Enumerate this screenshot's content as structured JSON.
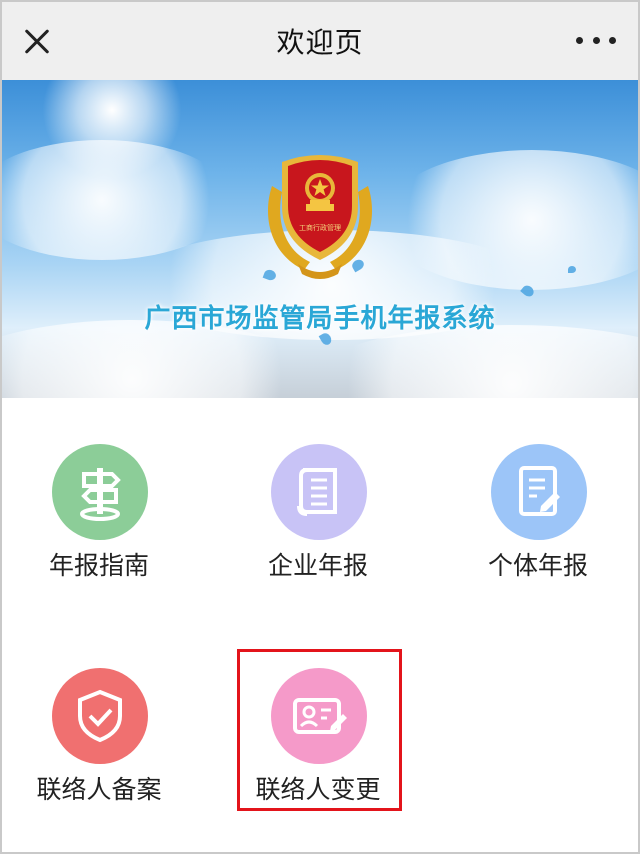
{
  "titlebar": {
    "title": "欢迎页",
    "close_icon": "close-icon",
    "more_icon": "more-horizontal-icon"
  },
  "banner": {
    "title": "广西市场监管局手机年报系统",
    "emblem_icon": "market-regulation-emblem",
    "emblem_text": "工商行政管理"
  },
  "menu": [
    {
      "label": "年报指南",
      "icon": "signpost-icon",
      "color": "#8ccd98"
    },
    {
      "label": "企业年报",
      "icon": "scroll-icon",
      "color": "#c8c3f6"
    },
    {
      "label": "个体年报",
      "icon": "document-edit-icon",
      "color": "#9cc5f8"
    },
    {
      "label": "联络人备案",
      "icon": "shield-check-icon",
      "color": "#f07070"
    },
    {
      "label": "联络人变更",
      "icon": "id-card-edit-icon",
      "color": "#f59ac9",
      "highlighted": true
    }
  ],
  "colors": {
    "highlight": "#e3141b",
    "banner_text": "#2aa7d6"
  }
}
